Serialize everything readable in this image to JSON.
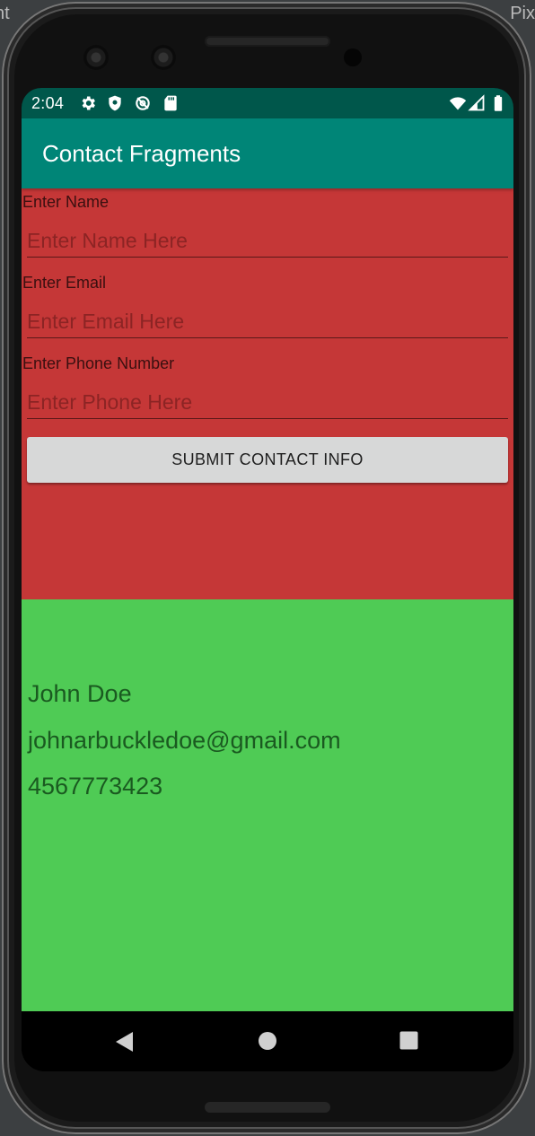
{
  "ide": {
    "left_text": "nt",
    "right_text": "Pix"
  },
  "status_bar": {
    "time": "2:04",
    "icons": [
      "settings-icon",
      "shield-icon",
      "sync-disabled-icon",
      "sd-card-icon"
    ],
    "right_icons": [
      "wifi-icon",
      "cell-signal-icon",
      "battery-icon"
    ]
  },
  "app_bar": {
    "title": "Contact Fragments",
    "color": "#008577"
  },
  "form": {
    "background": "#c53737",
    "name_label": "Enter Name",
    "name_placeholder": "Enter Name Here",
    "email_label": "Enter Email",
    "email_placeholder": "Enter Email Here",
    "phone_label": "Enter Phone Number",
    "phone_placeholder": "Enter Phone Here",
    "submit_label": "SUBMIT CONTACT INFO"
  },
  "display": {
    "background": "#4fcb55",
    "name": "John Doe",
    "email": "johnarbuckledoe@gmail.com",
    "phone": "4567773423"
  },
  "nav_bar": {
    "icons": [
      "back-icon",
      "home-icon",
      "recents-icon"
    ]
  }
}
